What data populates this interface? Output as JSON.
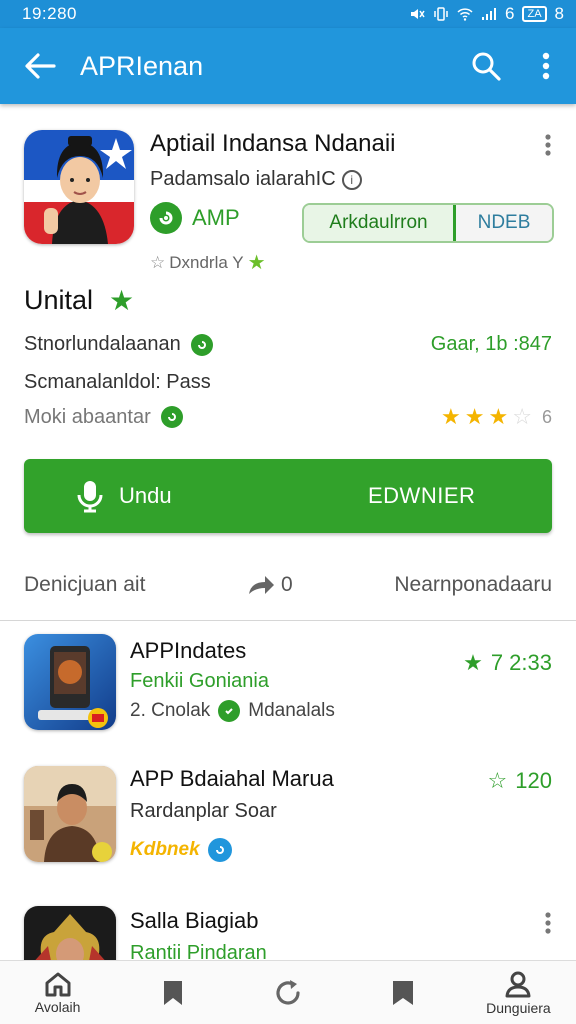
{
  "status_bar": {
    "time": "19:280",
    "battery": "ZA",
    "signal_text": "6",
    "extra": "8"
  },
  "app_bar": {
    "title": "APRIenan"
  },
  "app": {
    "name": "Aptiail Indansa Ndanaii",
    "developer": "Padamsalo ialarahIC",
    "badge": "AMP",
    "pill_left": "Arkdaulrron",
    "pill_right": "NDEB",
    "rated": "Dxndrla Y"
  },
  "section": {
    "title": "Unital",
    "row1_left": "Stnorlundalaanan",
    "row1_right": "Gaar, 1b :847",
    "row2_left": "Scmanalanldol: Pass",
    "row3_left": "Moki abaantar",
    "rating_count": "6",
    "stars": {
      "filled": 3,
      "total": 4
    }
  },
  "primary_button": {
    "left_label": "Undu",
    "right_label": "EDWNIER"
  },
  "actions": {
    "left": "Denicjuan ait",
    "share_count": "0",
    "right": "Nearnponadaaru"
  },
  "list": [
    {
      "title": "APPIndates",
      "subtitle": "Fenkii Goniania",
      "meta_left": "2. Cnolak",
      "meta_right": "Mdanalals",
      "rating": "7 2:33"
    },
    {
      "title": "APP Bdaiahal Marua",
      "subtitle": "Rardanplar Soar",
      "tag": "Kdbnek",
      "rating": "120"
    },
    {
      "title": "Salla Biagiab",
      "subtitle": "Rantii Pindaran"
    }
  ],
  "bottom_nav": {
    "home": "Avolaih",
    "profile": "Dunguiera"
  },
  "colors": {
    "primary_blue": "#2196dc",
    "green": "#32a22b",
    "star": "#f4b400"
  }
}
